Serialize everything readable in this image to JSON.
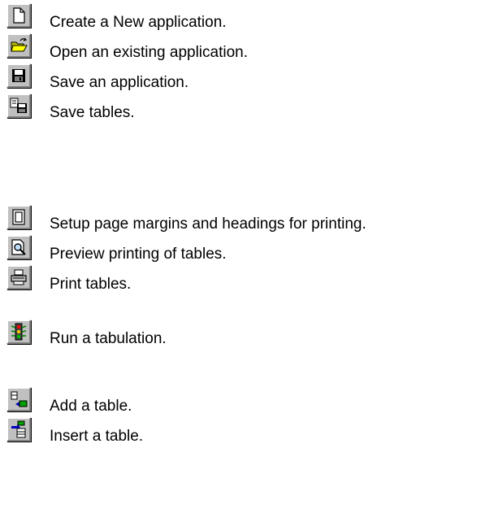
{
  "toolbar_help": {
    "items": [
      {
        "id": "new",
        "icon": "new-document-icon",
        "label": "Create a New application."
      },
      {
        "id": "open",
        "icon": "open-folder-icon",
        "label": "Open an existing application."
      },
      {
        "id": "save",
        "icon": "floppy-disk-icon",
        "label": "Save an application."
      },
      {
        "id": "save-tables",
        "icon": "save-tables-icon",
        "label": "Save tables."
      },
      {
        "id": "page-setup",
        "icon": "page-setup-icon",
        "label": "Setup page margins and headings for printing."
      },
      {
        "id": "print-preview",
        "icon": "print-preview-icon",
        "label": "Preview printing of tables."
      },
      {
        "id": "print",
        "icon": "printer-icon",
        "label": "Print tables."
      },
      {
        "id": "run",
        "icon": "traffic-light-icon",
        "label": "Run a tabulation."
      },
      {
        "id": "add-table",
        "icon": "add-table-icon",
        "label": "Add a table."
      },
      {
        "id": "insert-table",
        "icon": "insert-table-icon",
        "label": "Insert a table."
      }
    ]
  },
  "colors": {
    "button_face": "#c0c0c0",
    "highlight": "#ffffff",
    "shadow": "#808080",
    "folder_yellow": "#ffff00",
    "green": "#00a000",
    "red": "#ff0000"
  }
}
